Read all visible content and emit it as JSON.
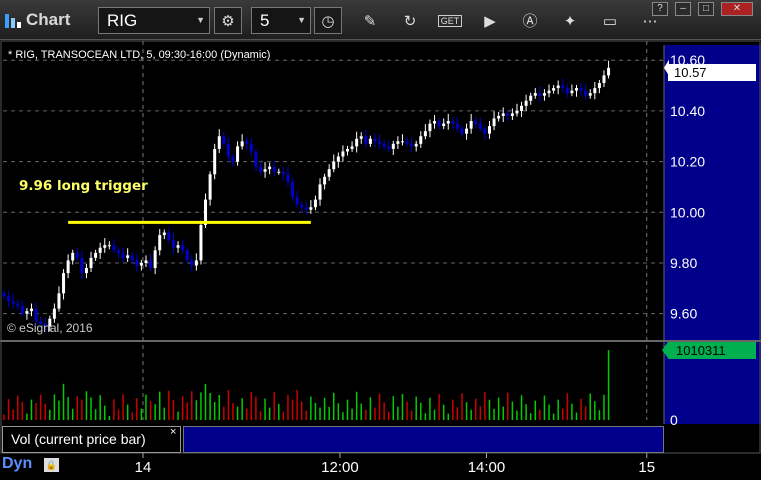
{
  "window": {
    "title": "Chart",
    "symbol_input": "RIG",
    "interval_input": "5",
    "window_buttons": [
      "?",
      "–",
      "□",
      "✕"
    ]
  },
  "chart_header": "* RIG, TRANSOCEAN LTD, 5, 09:30-16:00 (Dynamic)",
  "annotation": "9.96 long trigger",
  "copyright": "© eSignal, 2016",
  "price_label": "10.57",
  "volume_label": "1010311",
  "study_label": "Vol (current price bar)",
  "study_close": "×",
  "footer_symbol": "Dyn",
  "colors": {
    "background": "#000000",
    "up_candle": "#ffffff",
    "down_candle": "#0000cc",
    "volume_up": "#00cc00",
    "volume_down": "#cc0000",
    "trigger_line": "#ffff00",
    "axis_panel": "#00008b"
  },
  "chart_data": [
    {
      "type": "candlestick",
      "title": "* RIG, TRANSOCEAN LTD, 5, 09:30-16:00 (Dynamic)",
      "ylim": [
        9.5,
        10.66
      ],
      "y_ticks": [
        "10.60",
        "10.40",
        "10.20",
        "10.00",
        "9.80",
        "9.60"
      ],
      "y_tick_values": [
        10.6,
        10.4,
        10.2,
        10.0,
        9.8,
        9.6
      ],
      "x_ticks": [
        "14",
        "12:00",
        "14:00",
        "15"
      ],
      "x_tick_bar_index": [
        31,
        74,
        106,
        141
      ],
      "session_separators": [
        31,
        141
      ],
      "grid": true,
      "horizontal_line": {
        "label": "9.96 long trigger",
        "value": 9.96,
        "from_bar": 14,
        "to_bar": 67
      },
      "last_price": 10.57,
      "closes": [
        9.67,
        9.65,
        9.64,
        9.63,
        9.6,
        9.61,
        9.62,
        9.57,
        9.56,
        9.55,
        9.58,
        9.62,
        9.68,
        9.76,
        9.81,
        9.84,
        9.82,
        9.76,
        9.78,
        9.82,
        9.84,
        9.86,
        9.87,
        9.87,
        9.85,
        9.84,
        9.82,
        9.83,
        9.81,
        9.79,
        9.8,
        9.81,
        9.78,
        9.85,
        9.91,
        9.92,
        9.89,
        9.86,
        9.87,
        9.85,
        9.81,
        9.79,
        9.81,
        9.95,
        10.05,
        10.15,
        10.25,
        10.3,
        10.27,
        10.22,
        10.2,
        10.26,
        10.28,
        10.27,
        10.24,
        10.18,
        10.16,
        10.17,
        10.18,
        10.16,
        10.16,
        10.15,
        10.12,
        10.06,
        10.03,
        10.02,
        10.01,
        10.02,
        10.05,
        10.11,
        10.14,
        10.17,
        10.2,
        10.22,
        10.24,
        10.25,
        10.26,
        10.29,
        10.3,
        10.27,
        10.29,
        10.28,
        10.27,
        10.26,
        10.25,
        10.27,
        10.28,
        10.28,
        10.27,
        10.26,
        10.27,
        10.3,
        10.32,
        10.35,
        10.36,
        10.34,
        10.35,
        10.36,
        10.35,
        10.33,
        10.31,
        10.33,
        10.36,
        10.35,
        10.33,
        10.31,
        10.34,
        10.37,
        10.38,
        10.39,
        10.38,
        10.39,
        10.4,
        10.42,
        10.44,
        10.46,
        10.47,
        10.46,
        10.47,
        10.48,
        10.49,
        10.5,
        10.49,
        10.47,
        10.48,
        10.49,
        10.48,
        10.46,
        10.47,
        10.49,
        10.51,
        10.54,
        10.57
      ],
      "volume": {
        "label": "Vol (current price bar)",
        "last_value": 1010311,
        "axis_ticks": [
          "0"
        ]
      }
    }
  ]
}
